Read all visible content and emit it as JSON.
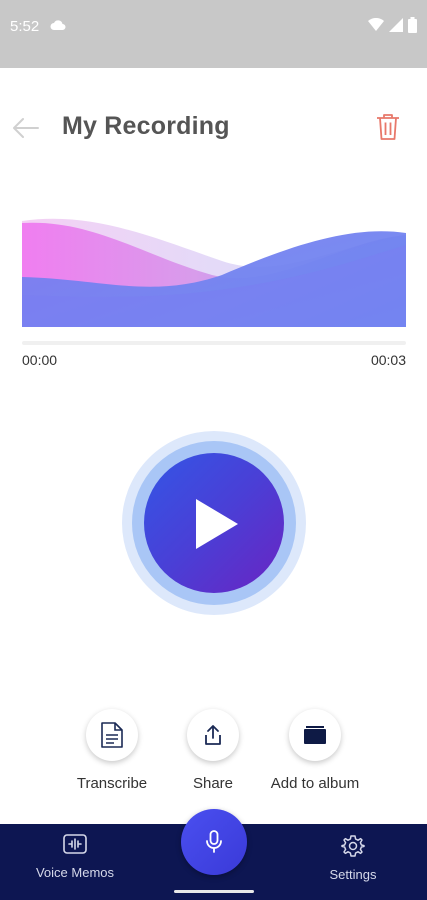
{
  "status_bar": {
    "time": "5:52",
    "icons": [
      "cloud-icon",
      "wifi-icon",
      "signal-icon",
      "battery-icon"
    ],
    "background": "#c8c8c8"
  },
  "header": {
    "title": "My Recording",
    "back_icon": "arrow-left-icon",
    "delete_icon": "trash-icon",
    "delete_color": "#e8786a"
  },
  "player": {
    "current_time": "00:00",
    "total_time": "00:03",
    "progress": 0,
    "play_icon": "play-icon",
    "colors": {
      "accent_blue": "#3356e6",
      "accent_purple": "#6a24c2",
      "wave_pink": "#f080ee",
      "wave_blue": "#6e86f2"
    }
  },
  "actions": [
    {
      "id": "transcribe",
      "label": "Transcribe",
      "icon": "document-icon"
    },
    {
      "id": "share",
      "label": "Share",
      "icon": "share-icon"
    },
    {
      "id": "album",
      "label": "Add to album",
      "icon": "folder-icon"
    }
  ],
  "bottom_nav": {
    "background": "#0d1652",
    "items": [
      {
        "id": "voice_memos",
        "label": "Voice Memos",
        "icon": "voice-memos-icon"
      },
      {
        "id": "record",
        "label": "",
        "icon": "microphone-icon"
      },
      {
        "id": "settings",
        "label": "Settings",
        "icon": "gear-icon"
      }
    ]
  }
}
